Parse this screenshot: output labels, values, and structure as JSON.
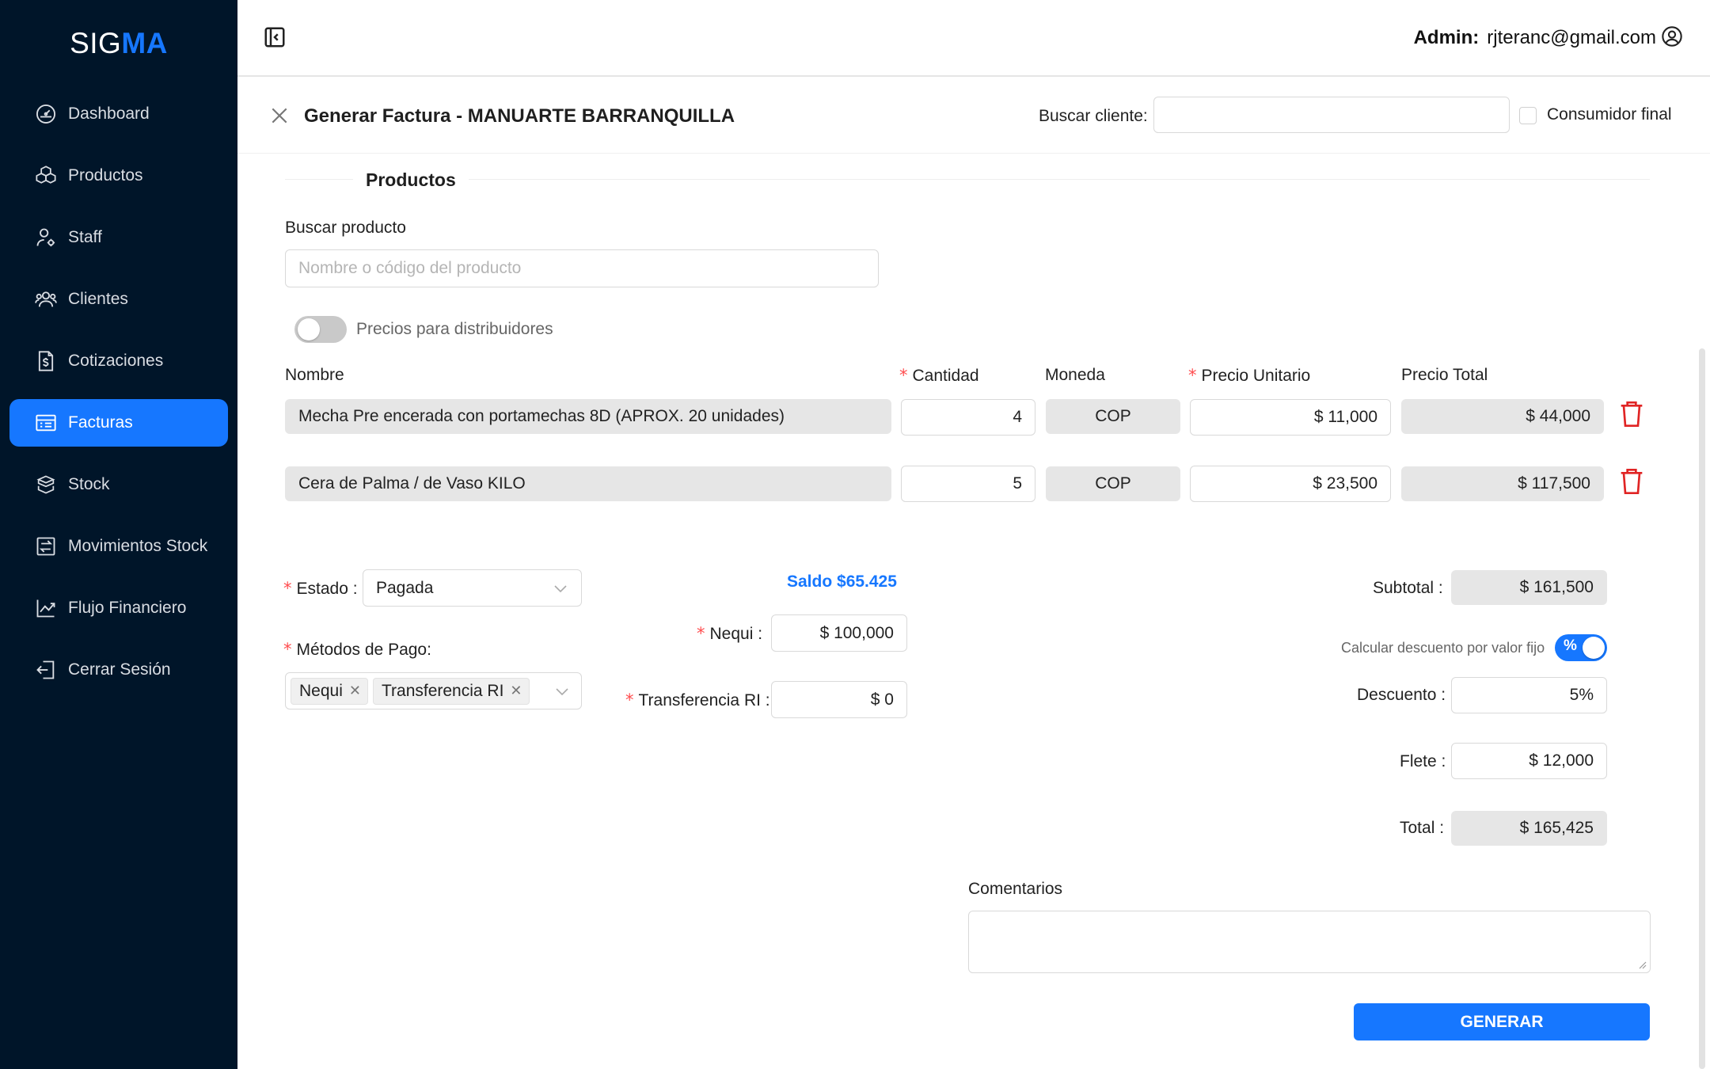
{
  "app": {
    "logo_a": "SIG",
    "logo_b": "MA"
  },
  "sidebar": {
    "items": [
      {
        "label": "Dashboard",
        "icon": "dashboard-icon",
        "active": false
      },
      {
        "label": "Productos",
        "icon": "boxes-icon",
        "active": false
      },
      {
        "label": "Staff",
        "icon": "user-gear-icon",
        "active": false
      },
      {
        "label": "Clientes",
        "icon": "users-icon",
        "active": false
      },
      {
        "label": "Cotizaciones",
        "icon": "document-dollar-icon",
        "active": false
      },
      {
        "label": "Facturas",
        "icon": "invoice-icon",
        "active": true
      },
      {
        "label": "Stock",
        "icon": "box-stack-icon",
        "active": false
      },
      {
        "label": "Movimientos Stock",
        "icon": "transfer-icon",
        "active": false
      },
      {
        "label": "Flujo Financiero",
        "icon": "chart-line-icon",
        "active": false
      },
      {
        "label": "Cerrar Sesión",
        "icon": "logout-icon",
        "active": false
      }
    ]
  },
  "header": {
    "admin_label": "Admin:",
    "email": "rjteranc@gmail.com"
  },
  "modal": {
    "title": "Generar Factura - MANUARTE BARRANQUILLA",
    "buscar_cliente_label": "Buscar cliente:",
    "buscar_cliente_value": "",
    "consumidor_final": "Consumidor final"
  },
  "productos": {
    "section_title": "Productos",
    "buscar_label": "Buscar producto",
    "buscar_placeholder": "Nombre o código del producto",
    "precios_distribuidores": "Precios para distribuidores",
    "columns": {
      "nombre": "Nombre",
      "cantidad": "Cantidad",
      "moneda": "Moneda",
      "precio_unitario": "Precio Unitario",
      "precio_total": "Precio Total"
    },
    "rows": [
      {
        "nombre": "Mecha Pre encerada con portamechas 8D (APROX. 20 unidades)",
        "cantidad": "4",
        "moneda": "COP",
        "precio_unitario": "$ 11,000",
        "precio_total": "$ 44,000"
      },
      {
        "nombre": "Cera de Palma / de Vaso KILO",
        "cantidad": "5",
        "moneda": "COP",
        "precio_unitario": "$ 23,500",
        "precio_total": "$ 117,500"
      }
    ]
  },
  "pago": {
    "estado_label": "Estado",
    "estado_value": "Pagada",
    "metodos_label": "Métodos de Pago:",
    "metodos": [
      "Nequi",
      "Transferencia RI"
    ],
    "saldo": "Saldo $65.425",
    "nequi_label": "Nequi",
    "nequi_value": "$ 100,000",
    "transferencia_label": "Transferencia RI",
    "transferencia_value": "$ 0"
  },
  "totales": {
    "subtotal_label": "Subtotal",
    "subtotal_value": "$ 161,500",
    "calc_descuento_label": "Calcular descuento por valor fijo",
    "descuento_toggle": "%",
    "descuento_label": "Descuento",
    "descuento_value": "5%",
    "flete_label": "Flete",
    "flete_value": "$ 12,000",
    "total_label": "Total",
    "total_value": "$ 165,425"
  },
  "comentarios": {
    "label": "Comentarios",
    "value": ""
  },
  "actions": {
    "generar": "GENERAR"
  },
  "colors": {
    "sidebar_bg": "#001529",
    "accent": "#1677ff",
    "danger": "#ff4d4f",
    "trash": "#e02424"
  }
}
